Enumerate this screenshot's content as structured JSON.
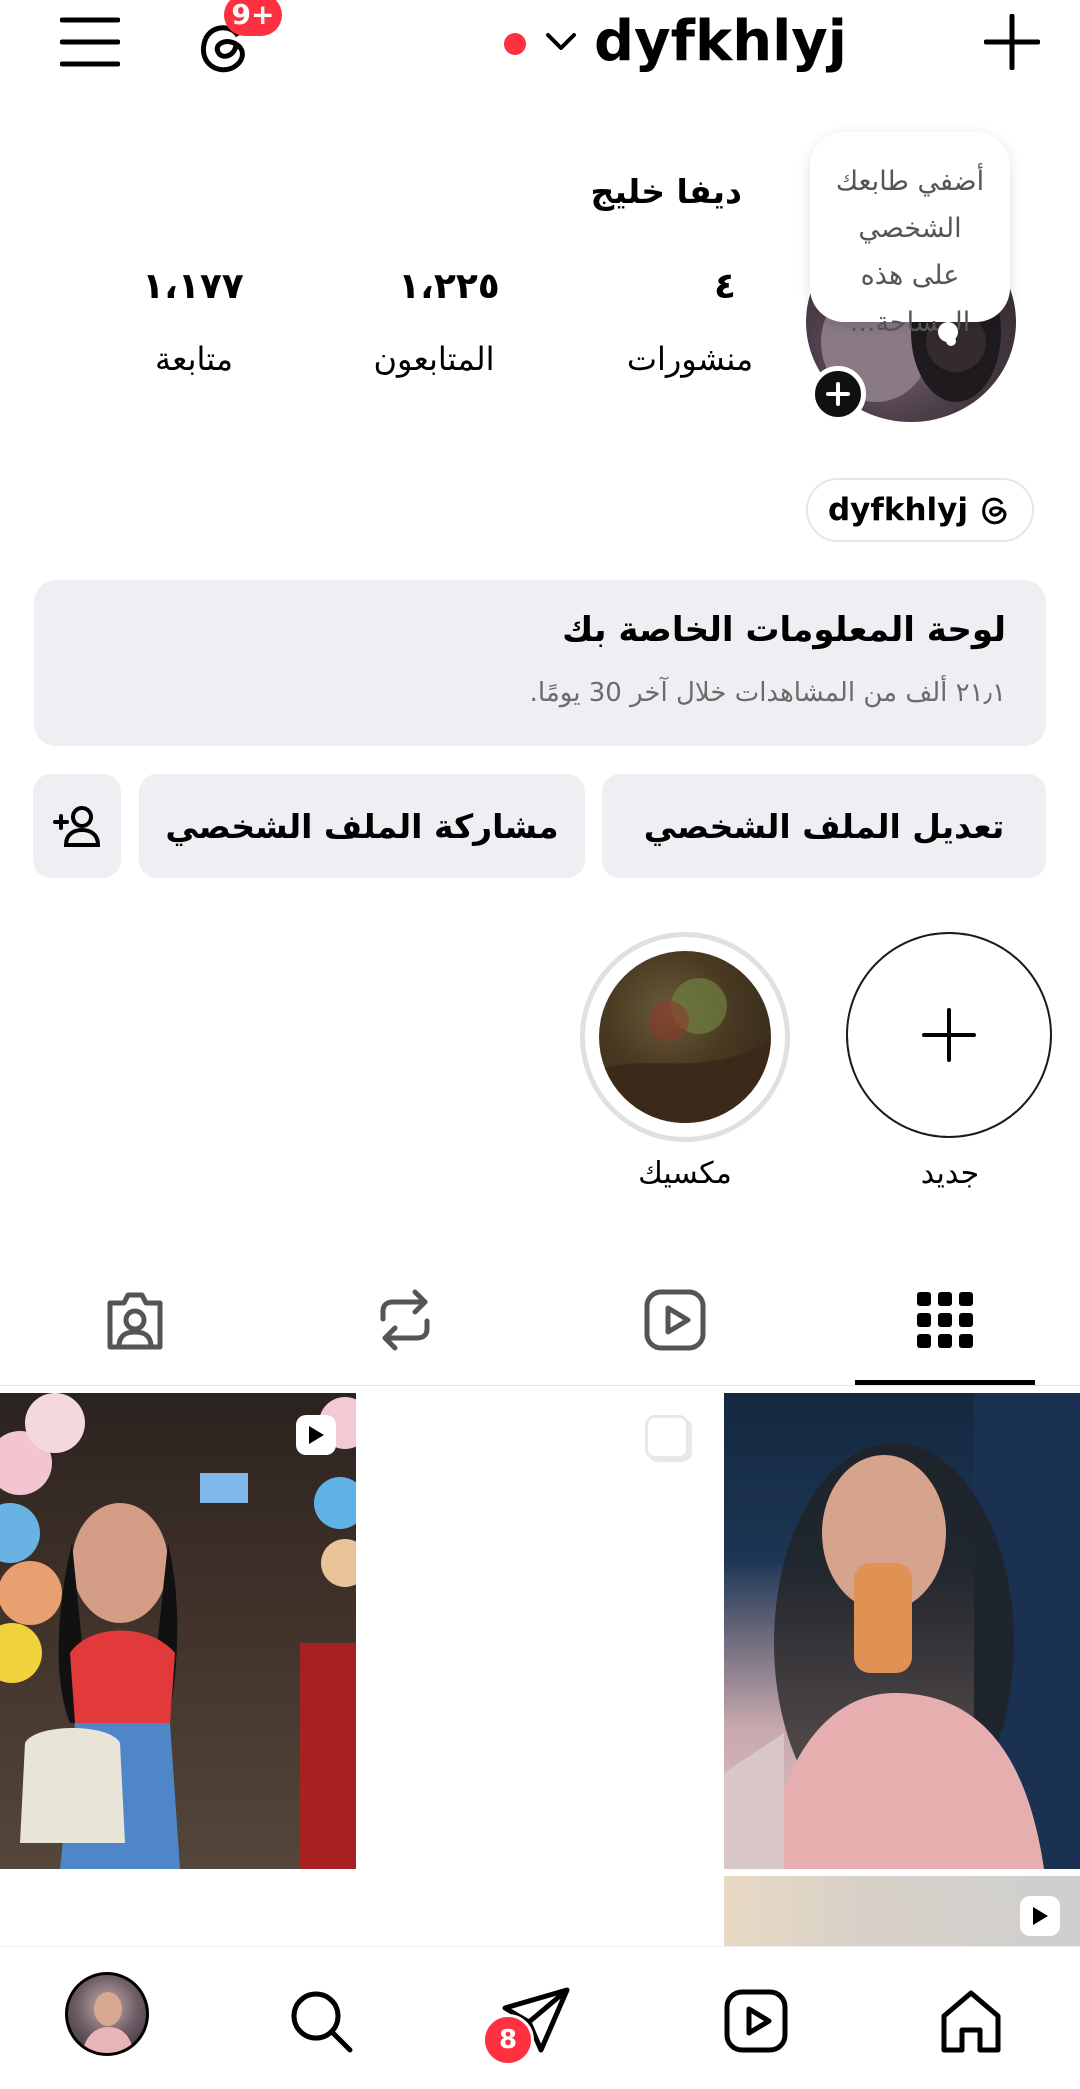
{
  "header": {
    "username": "dyfkhlyj",
    "threads_badge": "9+",
    "menu_icon": "hamburger-menu-icon",
    "create_icon": "plus-icon"
  },
  "profile": {
    "display_name": "ديفا خليج",
    "note_bubble": "أضفي طابعك الشخصي على هذه المساحة...",
    "stats": [
      {
        "value": "٤",
        "label": "منشورات"
      },
      {
        "value": "١،٢٢٥",
        "label": "المتابعون"
      },
      {
        "value": "١،١٧٧",
        "label": "متابعة"
      }
    ],
    "threads_handle": "dyfkhlyj"
  },
  "dashboard": {
    "title": "لوحة المعلومات الخاصة بك",
    "subtitle": "٢١٫١ ألف من المشاهدات خلال آخر 30 يومًا."
  },
  "actions": {
    "edit_profile": "تعديل الملف الشخصي",
    "share_profile": "مشاركة الملف الشخصي"
  },
  "highlights": [
    {
      "label": "جديد",
      "type": "new"
    },
    {
      "label": "مكسيك",
      "type": "story"
    }
  ],
  "tabs": [
    "grid-icon",
    "reels-icon",
    "reposts-icon",
    "tagged-icon"
  ],
  "bottom_nav": {
    "messages_badge": "8",
    "items": [
      "home-icon",
      "reels-icon",
      "messages-icon",
      "search-icon",
      "profile-avatar"
    ]
  },
  "colors": {
    "accent_red": "#ff3040",
    "panel_gray": "#efeff3",
    "border_gray": "#dbdbdb"
  }
}
